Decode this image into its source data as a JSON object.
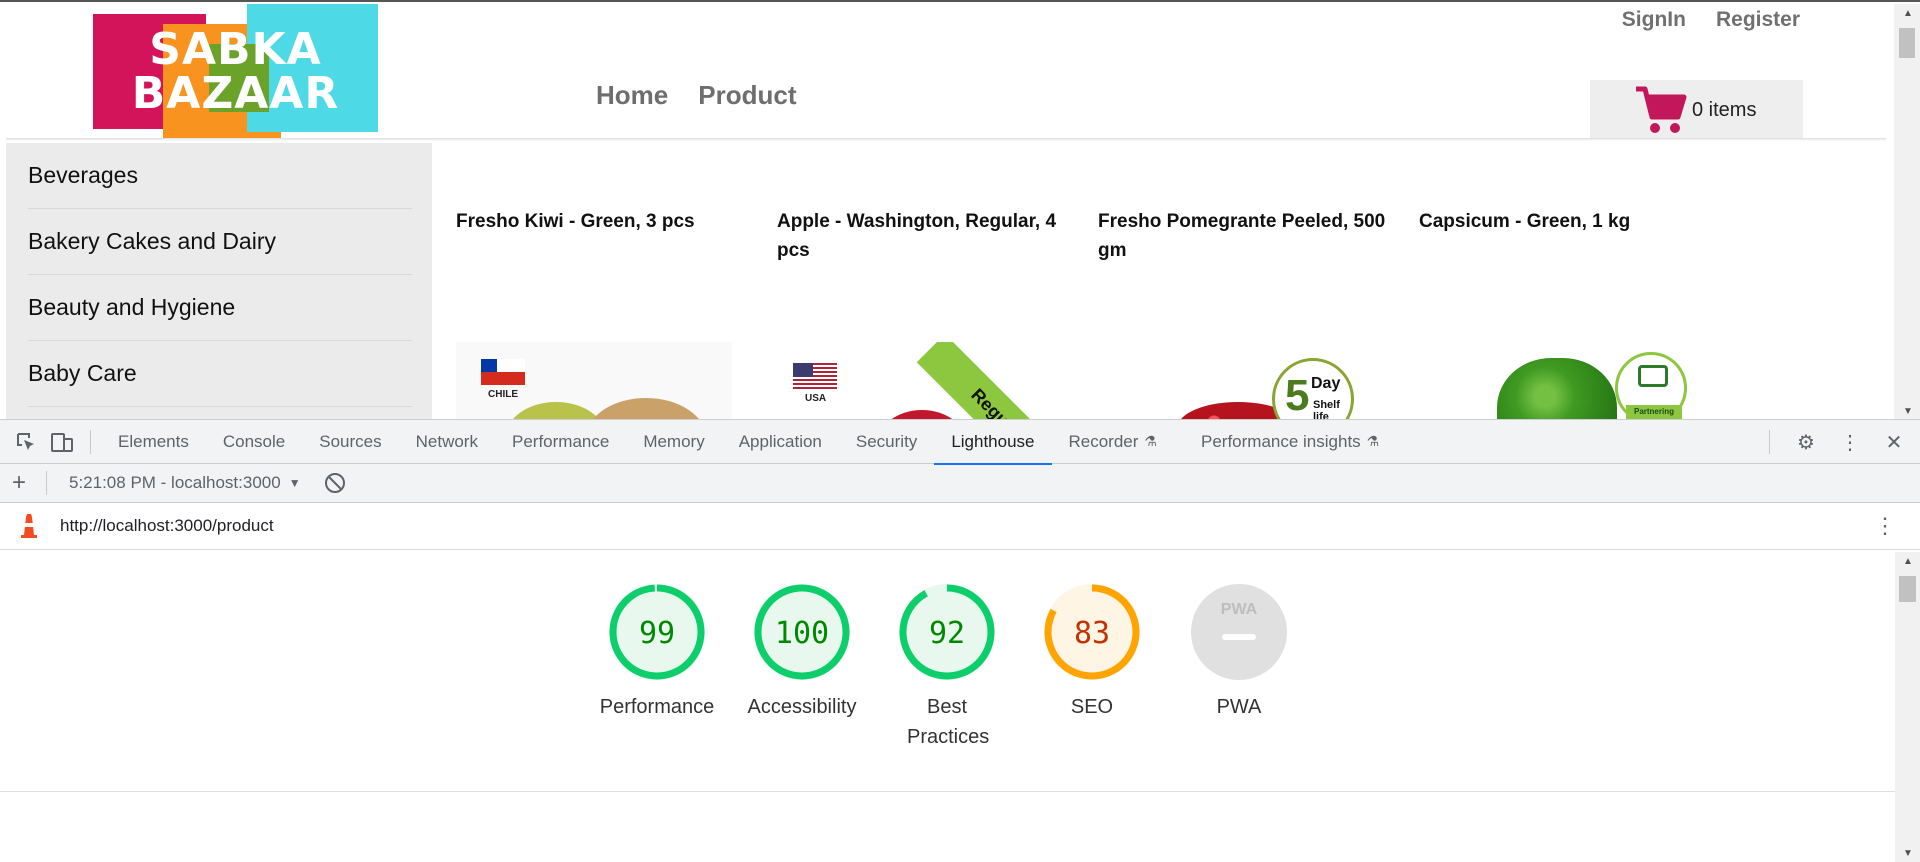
{
  "site": {
    "logo": {
      "line1": "SABKA",
      "line2": "BAZAAR"
    },
    "auth": {
      "signin": "SignIn",
      "register": "Register"
    },
    "nav": [
      {
        "label": "Home"
      },
      {
        "label": "Product"
      }
    ],
    "cart": {
      "label": "0 items",
      "icon": "cart-icon",
      "icon_color": "#c2185b"
    },
    "sidebar": [
      {
        "label": "Beverages"
      },
      {
        "label": "Bakery Cakes and Dairy"
      },
      {
        "label": "Beauty and Hygiene"
      },
      {
        "label": "Baby Care"
      }
    ],
    "products": [
      {
        "name": "Fresho Kiwi - Green, 3 pcs",
        "flag_label": "CHILE"
      },
      {
        "name": "Apple - Washington, Regular, 4 pcs",
        "flag_label": "USA",
        "ribbon": "Regular"
      },
      {
        "name": "Fresho Pomegrante Peeled, 500 gm",
        "badge_big": "5",
        "badge_small": "Day",
        "badge_tiny": "Shelf life"
      },
      {
        "name": "Capsicum - Green, 1 kg",
        "badge_tag": "Partnering with"
      }
    ]
  },
  "devtools": {
    "tabs": [
      {
        "label": "Elements"
      },
      {
        "label": "Console"
      },
      {
        "label": "Sources"
      },
      {
        "label": "Network"
      },
      {
        "label": "Performance"
      },
      {
        "label": "Memory"
      },
      {
        "label": "Application"
      },
      {
        "label": "Security"
      },
      {
        "label": "Lighthouse",
        "active": true
      },
      {
        "label": "Recorder"
      },
      {
        "label": "Performance insights"
      }
    ],
    "toolbar": {
      "report": "5:21:08 PM - localhost:3000"
    },
    "url": "http://localhost:3000/product",
    "scores": [
      {
        "label": "Performance",
        "value": "99",
        "score": 0.99,
        "status": "pass"
      },
      {
        "label": "Accessibility",
        "value": "100",
        "score": 1.0,
        "status": "pass"
      },
      {
        "label": "Best Practices",
        "value": "92",
        "score": 0.92,
        "status": "pass"
      },
      {
        "label": "SEO",
        "value": "83",
        "score": 0.83,
        "status": "average"
      },
      {
        "label": "PWA",
        "value": "PWA",
        "score": null,
        "status": "na"
      }
    ],
    "colors": {
      "pass": "#0cce6b",
      "pass_bg": "#e8f8ee",
      "pass_text": "#008800",
      "average": "#ffa400",
      "average_bg": "#fff5e5",
      "average_text": "#c33300",
      "na": "#e0e0e0",
      "active_tab": "#1a73e8"
    }
  }
}
